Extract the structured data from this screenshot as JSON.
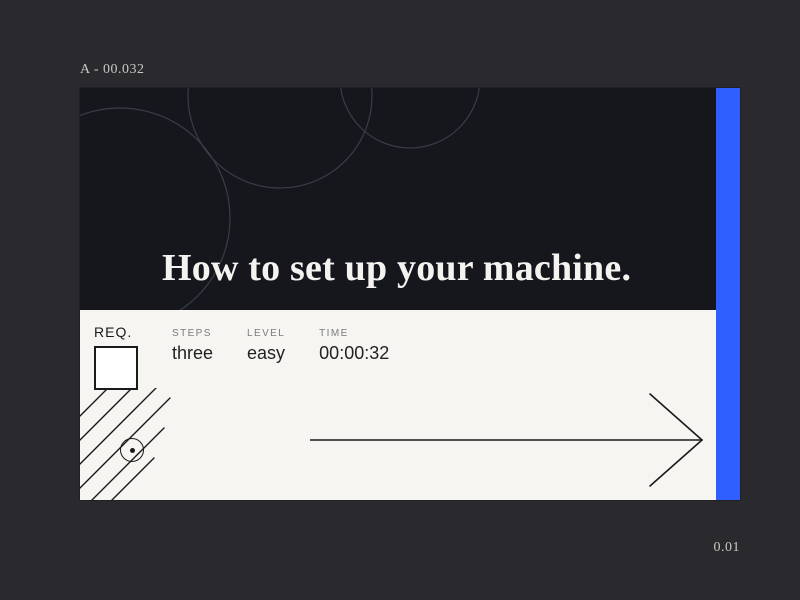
{
  "codes": {
    "top_left": "A - 00.032",
    "bottom_right": "0.01"
  },
  "accent_hex": "#2f5fff",
  "hero": {
    "title": "How to set up your machine."
  },
  "req": {
    "label": "REQ."
  },
  "meta": {
    "steps": {
      "label": "STEPS",
      "value": "three"
    },
    "level": {
      "label": "LEVEL",
      "value": "easy"
    },
    "time": {
      "label": "TIME",
      "value": "00:00:32"
    }
  }
}
